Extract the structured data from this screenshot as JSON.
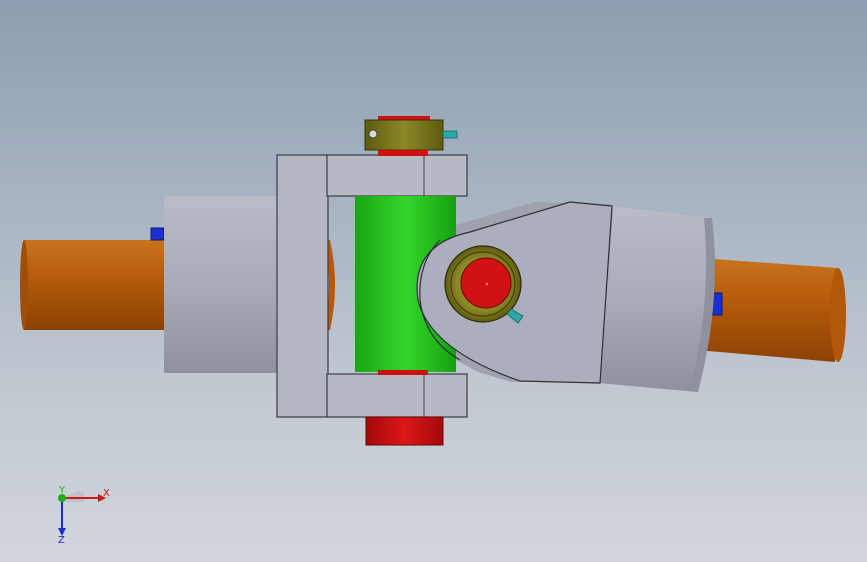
{
  "viewport": {
    "background_top": "#8e9db1",
    "background_bottom": "#d2d6dc"
  },
  "model": {
    "parts": [
      {
        "name": "left-shaft",
        "color": "#b45a0a"
      },
      {
        "name": "left-hub",
        "color": "#a7a9b4"
      },
      {
        "name": "left-yoke",
        "color": "#b4b6c2"
      },
      {
        "name": "cross-spider-body",
        "color": "#22c51a"
      },
      {
        "name": "bearing-cap",
        "color": "#cf1010"
      },
      {
        "name": "lock-collar",
        "color": "#7d7a1e"
      },
      {
        "name": "grease-fitting",
        "color": "#2aa7a7"
      },
      {
        "name": "right-yoke",
        "color": "#adaebd"
      },
      {
        "name": "right-hub",
        "color": "#a4a6b2"
      },
      {
        "name": "right-shaft",
        "color": "#b45a0a"
      },
      {
        "name": "key",
        "color": "#1c2fd0"
      }
    ]
  },
  "triad": {
    "x_label": "X",
    "y_label": "Y",
    "z_label": "Z",
    "x_color": "#d01818",
    "y_color": "#18b018",
    "z_color": "#1830c8"
  }
}
